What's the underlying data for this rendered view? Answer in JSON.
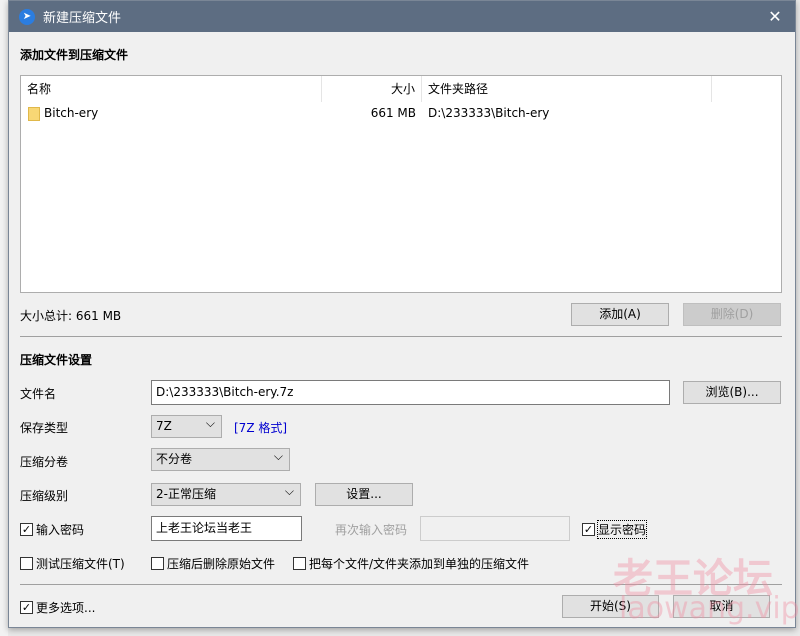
{
  "window": {
    "title": "新建压缩文件",
    "close": "✕"
  },
  "add_section": {
    "heading": "添加文件到压缩文件",
    "columns": [
      "名称",
      "大小",
      "文件夹路径"
    ],
    "rows": [
      {
        "name": "Bitch-ery",
        "size": "661 MB",
        "path": "D:\\233333\\Bitch-ery"
      }
    ],
    "total": "大小总计: 661 MB",
    "add": "添加(A)",
    "delete": "删除(D)"
  },
  "settings": {
    "heading": "压缩文件设置",
    "filename_label": "文件名",
    "filename": "D:\\233333\\Bitch-ery.7z",
    "browse": "浏览(B)...",
    "type_label": "保存类型",
    "type": "7Z",
    "type_link": "[7Z 格式]",
    "split_label": "压缩分卷",
    "split": "不分卷",
    "level_label": "压缩级别",
    "level": "2-正常压缩",
    "settings_btn": "设置...",
    "password_label": "输入密码",
    "password": "上老王论坛当老王",
    "password_checked": true,
    "repeat_label": "再次输入密码",
    "repeat": "",
    "show_password": "显示密码",
    "show_password_checked": true,
    "test": "测试压缩文件(T)",
    "delete_after": "压缩后删除原始文件",
    "each_separate": "把每个文件/文件夹添加到单独的压缩文件",
    "more": "更多选项...",
    "more_checked": true,
    "start": "开始(S)",
    "cancel": "取消"
  },
  "watermark": {
    "line1": "老王论坛",
    "line2": "laowang.vip"
  }
}
